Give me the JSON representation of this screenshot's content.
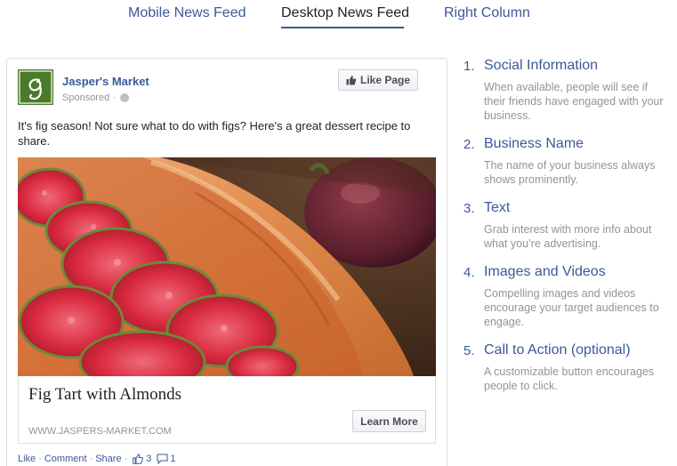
{
  "tabs": [
    {
      "label": "Mobile News Feed",
      "active": false
    },
    {
      "label": "Desktop News Feed",
      "active": true
    },
    {
      "label": "Right Column",
      "active": false
    }
  ],
  "post": {
    "page_name": "Jasper's Market",
    "sponsored": "Sponsored",
    "avatar_letter": "g",
    "like_page_label": "Like Page",
    "text": "It's fig season! Not sure what to do with figs? Here's a great dessert recipe to share.",
    "link_title": "Fig Tart with Almonds",
    "link_domain": "WWW.JASPERS-MARKET.COM",
    "cta_label": "Learn More",
    "actions": {
      "like": "Like",
      "comment": "Comment",
      "share": "Share",
      "like_count": "3",
      "comment_count": "1",
      "separator": "·"
    }
  },
  "info_items": [
    {
      "number": "1.",
      "title": "Social Information",
      "description": "When available, people will see if their friends have engaged with your business."
    },
    {
      "number": "2.",
      "title": "Business Name",
      "description": "The name of your business always shows prominently."
    },
    {
      "number": "3.",
      "title": "Text",
      "description": "Grab interest with more info about what you’re advertising."
    },
    {
      "number": "4.",
      "title": "Images and Videos",
      "description": "Compelling images and videos encourage your target audiences to engage."
    },
    {
      "number": "5.",
      "title": "Call to Action (optional)",
      "description": "A customizable button encourages people to click."
    }
  ],
  "colors": {
    "brand_blue": "#3b5998",
    "muted_gray": "#90949c",
    "avatar_green": "#4a7b2b"
  },
  "icons": [
    "thumbs-up-icon",
    "globe-icon",
    "comment-icon"
  ]
}
